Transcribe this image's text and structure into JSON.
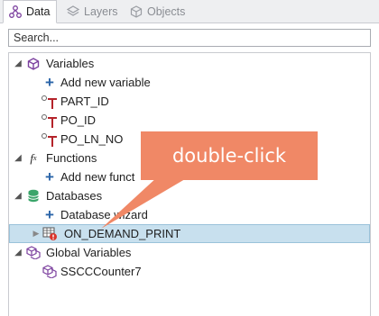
{
  "tabs": [
    {
      "label": "Data",
      "icon": "data-tree-icon",
      "active": true
    },
    {
      "label": "Layers",
      "icon": "layers-icon",
      "active": false
    },
    {
      "label": "Objects",
      "icon": "objects-cube-icon",
      "active": false
    }
  ],
  "search": {
    "placeholder": "Search..."
  },
  "tree": {
    "variables": {
      "label": "Variables",
      "add_label": "Add new variable",
      "items": [
        "PART_ID",
        "PO_ID",
        "PO_LN_NO"
      ]
    },
    "functions": {
      "label": "Functions",
      "add_label": "Add new funct"
    },
    "databases": {
      "label": "Databases",
      "wizard_label": "Database wizard",
      "items": [
        "ON_DEMAND_PRINT"
      ]
    },
    "global_variables": {
      "label": "Global Variables",
      "items": [
        "SSCCCounter7"
      ]
    }
  },
  "callout": {
    "text": "double-click"
  },
  "colors": {
    "callout": "#f08866",
    "selection": "#c8e0ee",
    "accent_blue": "#2a64a8",
    "variable_purple": "#7b3f9e",
    "database_green": "#3aa56a"
  }
}
